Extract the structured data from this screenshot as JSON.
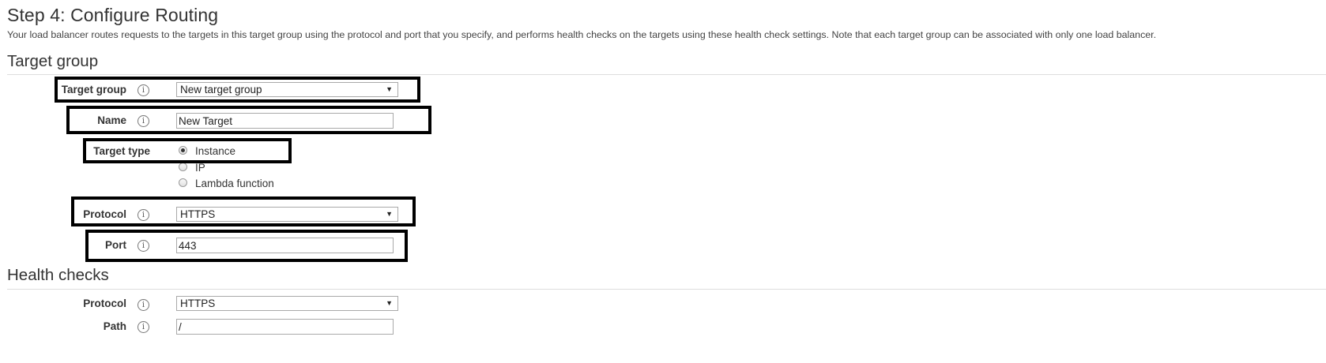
{
  "page": {
    "title": "Step 4: Configure Routing",
    "description": "Your load balancer routes requests to the targets in this target group using the protocol and port that you specify, and performs health checks on the targets using these health check settings. Note that each target group can be associated with only one load balancer."
  },
  "target_group_section": {
    "title": "Target group",
    "target_group": {
      "label": "Target group",
      "value": "New target group"
    },
    "name": {
      "label": "Name",
      "value": "New Target"
    },
    "target_type": {
      "label": "Target type",
      "options": [
        {
          "label": "Instance",
          "checked": true
        },
        {
          "label": "IP",
          "checked": false
        },
        {
          "label": "Lambda function",
          "checked": false
        }
      ]
    },
    "protocol": {
      "label": "Protocol",
      "value": "HTTPS"
    },
    "port": {
      "label": "Port",
      "value": "443"
    }
  },
  "health_checks_section": {
    "title": "Health checks",
    "protocol": {
      "label": "Protocol",
      "value": "HTTPS"
    },
    "path": {
      "label": "Path",
      "value": "/"
    }
  },
  "icons": {
    "info": "info-icon",
    "dropdown": "chevron-down-icon"
  },
  "glyphs": {
    "info": "i",
    "dropdown": "▼"
  },
  "colors": {
    "text": "#333333",
    "divider": "#dddddd",
    "highlight_border": "#000000"
  }
}
